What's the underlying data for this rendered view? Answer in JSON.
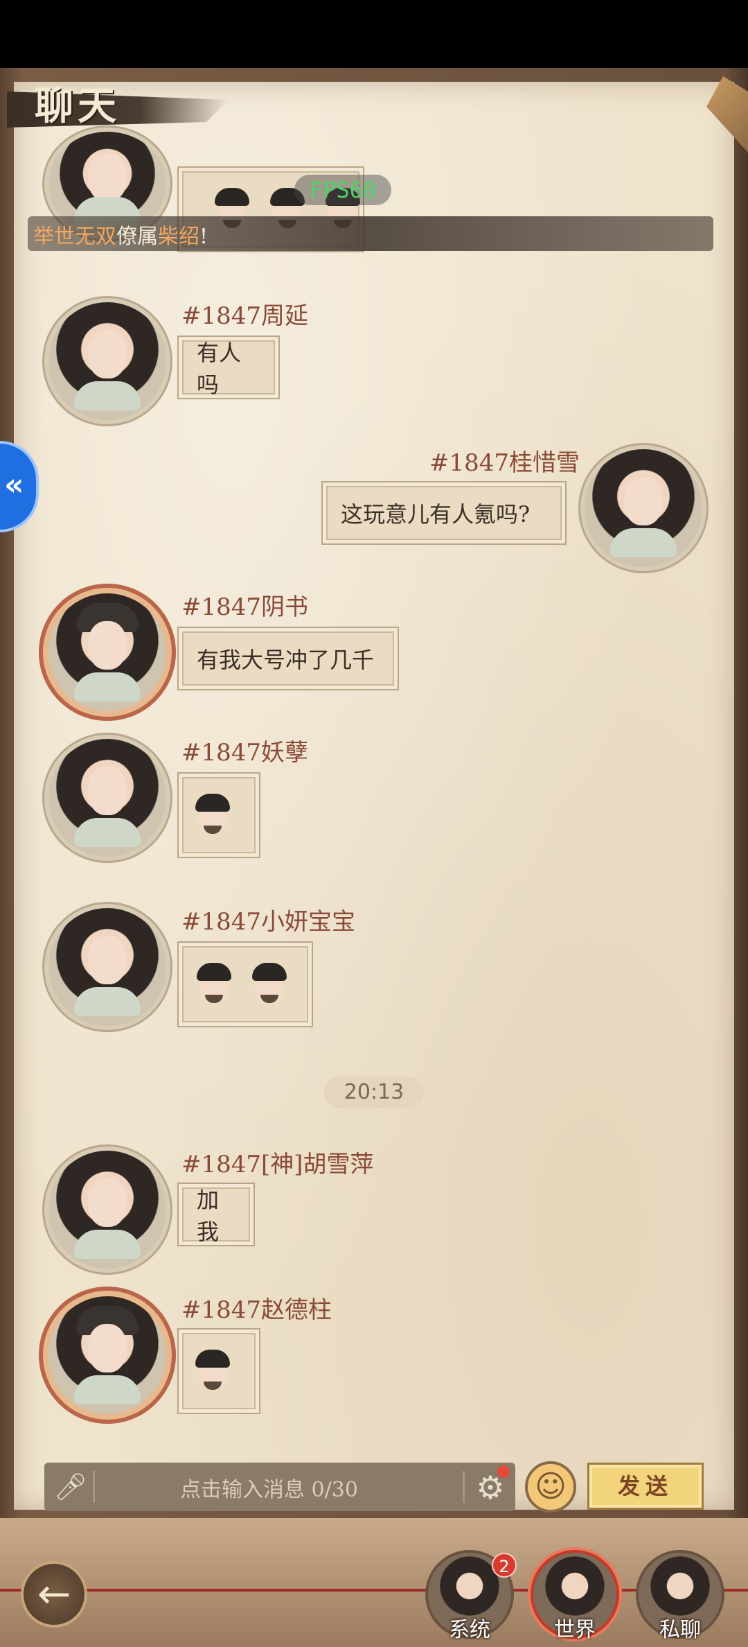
{
  "header": {
    "title": "聊天"
  },
  "overlay": {
    "fps": "FPS60"
  },
  "banner": {
    "prefix": "举世无双",
    "middle": "僚属",
    "highlight": "柴绍",
    "suffix": "!"
  },
  "messages": [
    {
      "name": "#1847周延",
      "text": "有人吗"
    },
    {
      "name": "#1847桂惜雪",
      "text": "这玩意儿有人氪吗?"
    },
    {
      "name": "#1847阴书",
      "text": "有我大号冲了几千"
    },
    {
      "name": "#1847妖孽",
      "text": ""
    },
    {
      "name": "#1847小妍宝宝",
      "text": ""
    },
    {
      "name": "#1847[神]胡雪萍",
      "text": "加我"
    },
    {
      "name": "#1847赵德柱",
      "text": ""
    }
  ],
  "time_divider": "20:13",
  "input": {
    "placeholder": "点击输入消息  0/30"
  },
  "buttons": {
    "send": "发送",
    "back": "←"
  },
  "tabs": [
    {
      "label": "系统",
      "badge": "2"
    },
    {
      "label": "世界"
    },
    {
      "label": "私聊"
    }
  ],
  "icons": [
    "mic-icon",
    "gear-icon",
    "emoji-icon",
    "back-arrow-icon"
  ],
  "colors": {
    "name_text": "#8a4a38",
    "send_bg": "#f2d47c",
    "fps_text": "#4ed26a",
    "badge": "#d93a2e"
  }
}
